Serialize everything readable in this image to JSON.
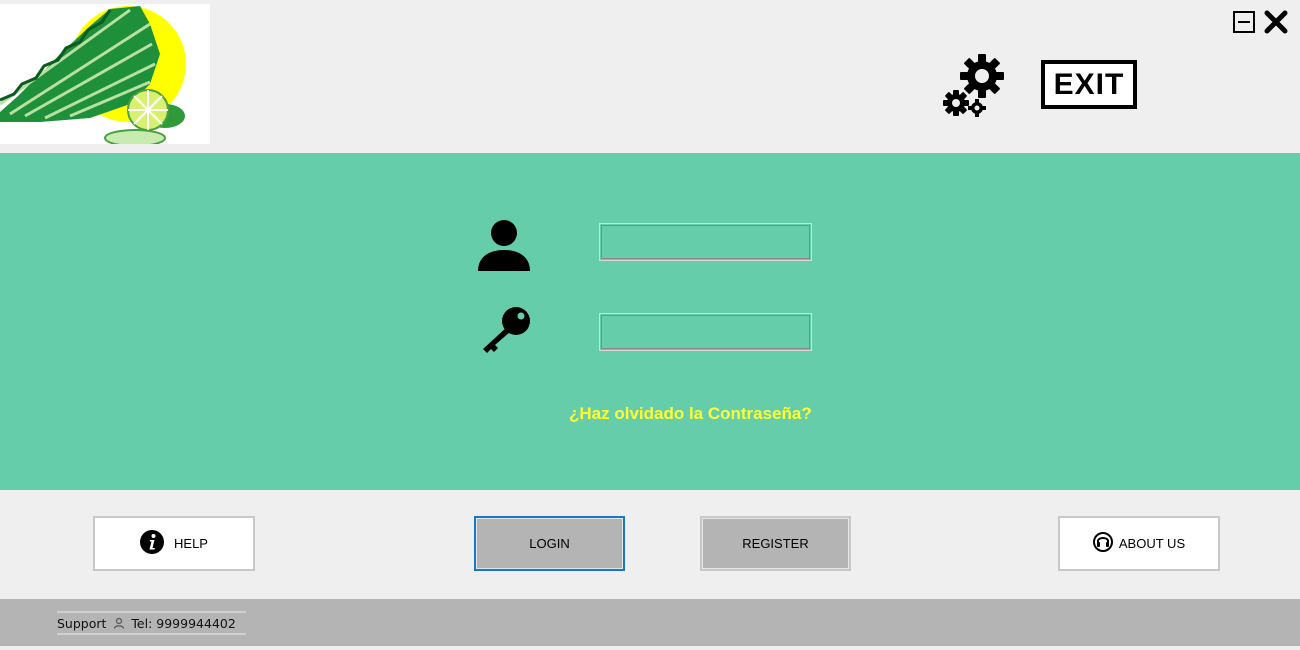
{
  "header": {
    "exit_label": "EXIT"
  },
  "form": {
    "username_value": "",
    "password_value": "",
    "forgot_link": "¿Haz olvidado la Contraseña?"
  },
  "buttons": {
    "help": "HELP",
    "login": "LOGIN",
    "register": "REGISTER",
    "about": "ABOUT US"
  },
  "footer": {
    "support_label": "Support",
    "phone": "Tel: 9999944402"
  },
  "colors": {
    "panel": "#66cdaa",
    "link": "#ffff33",
    "login_focus_border": "#1a76c6",
    "footer": "#b4b4b4"
  },
  "icons": [
    "minimize-icon",
    "close-icon",
    "gears-icon",
    "user-icon",
    "key-icon",
    "info-icon",
    "headset-icon",
    "person-outline-icon"
  ]
}
